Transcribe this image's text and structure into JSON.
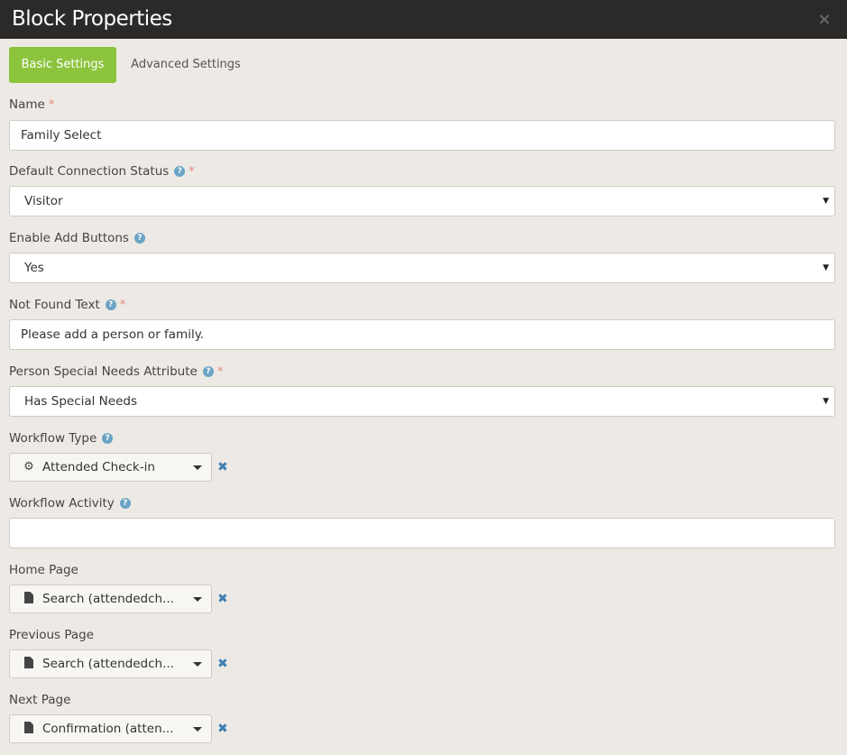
{
  "window": {
    "title": "Block Properties",
    "close_glyph": "×"
  },
  "tabs": [
    {
      "label": "Basic Settings",
      "active": true
    },
    {
      "label": "Advanced Settings",
      "active": false
    }
  ],
  "fields": {
    "name": {
      "label": "Name",
      "required": "*",
      "value": "Family Select"
    },
    "default_connection_status": {
      "label": "Default Connection Status",
      "help": "?",
      "required": "*",
      "value": "Visitor"
    },
    "enable_add_buttons": {
      "label": "Enable Add Buttons",
      "help": "?",
      "value": "Yes"
    },
    "not_found_text": {
      "label": "Not Found Text",
      "help": "?",
      "required": "*",
      "value": "Please add a person or family."
    },
    "person_special_needs_attribute": {
      "label": "Person Special Needs Attribute",
      "help": "?",
      "required": "*",
      "value": "Has Special Needs"
    },
    "workflow_type": {
      "label": "Workflow Type",
      "help": "?",
      "value": "Attended Check-in",
      "icon": "gears-icon"
    },
    "workflow_activity": {
      "label": "Workflow Activity",
      "help": "?",
      "value": ""
    },
    "home_page": {
      "label": "Home Page",
      "value": "Search (attendedch...",
      "icon": "file-icon"
    },
    "previous_page": {
      "label": "Previous Page",
      "value": "Search (attendedch...",
      "icon": "file-icon"
    },
    "next_page": {
      "label": "Next Page",
      "value": "Confirmation (atten...",
      "icon": "file-icon"
    }
  },
  "glyphs": {
    "select_caret": "▼",
    "clear": "✖",
    "gears": "⚙"
  },
  "colors": {
    "accent_green": "#8cc43d",
    "title_bar": "#2b2a28",
    "required": "#e4887d",
    "help": "#6ba4c4",
    "clear": "#3f7fb3"
  }
}
